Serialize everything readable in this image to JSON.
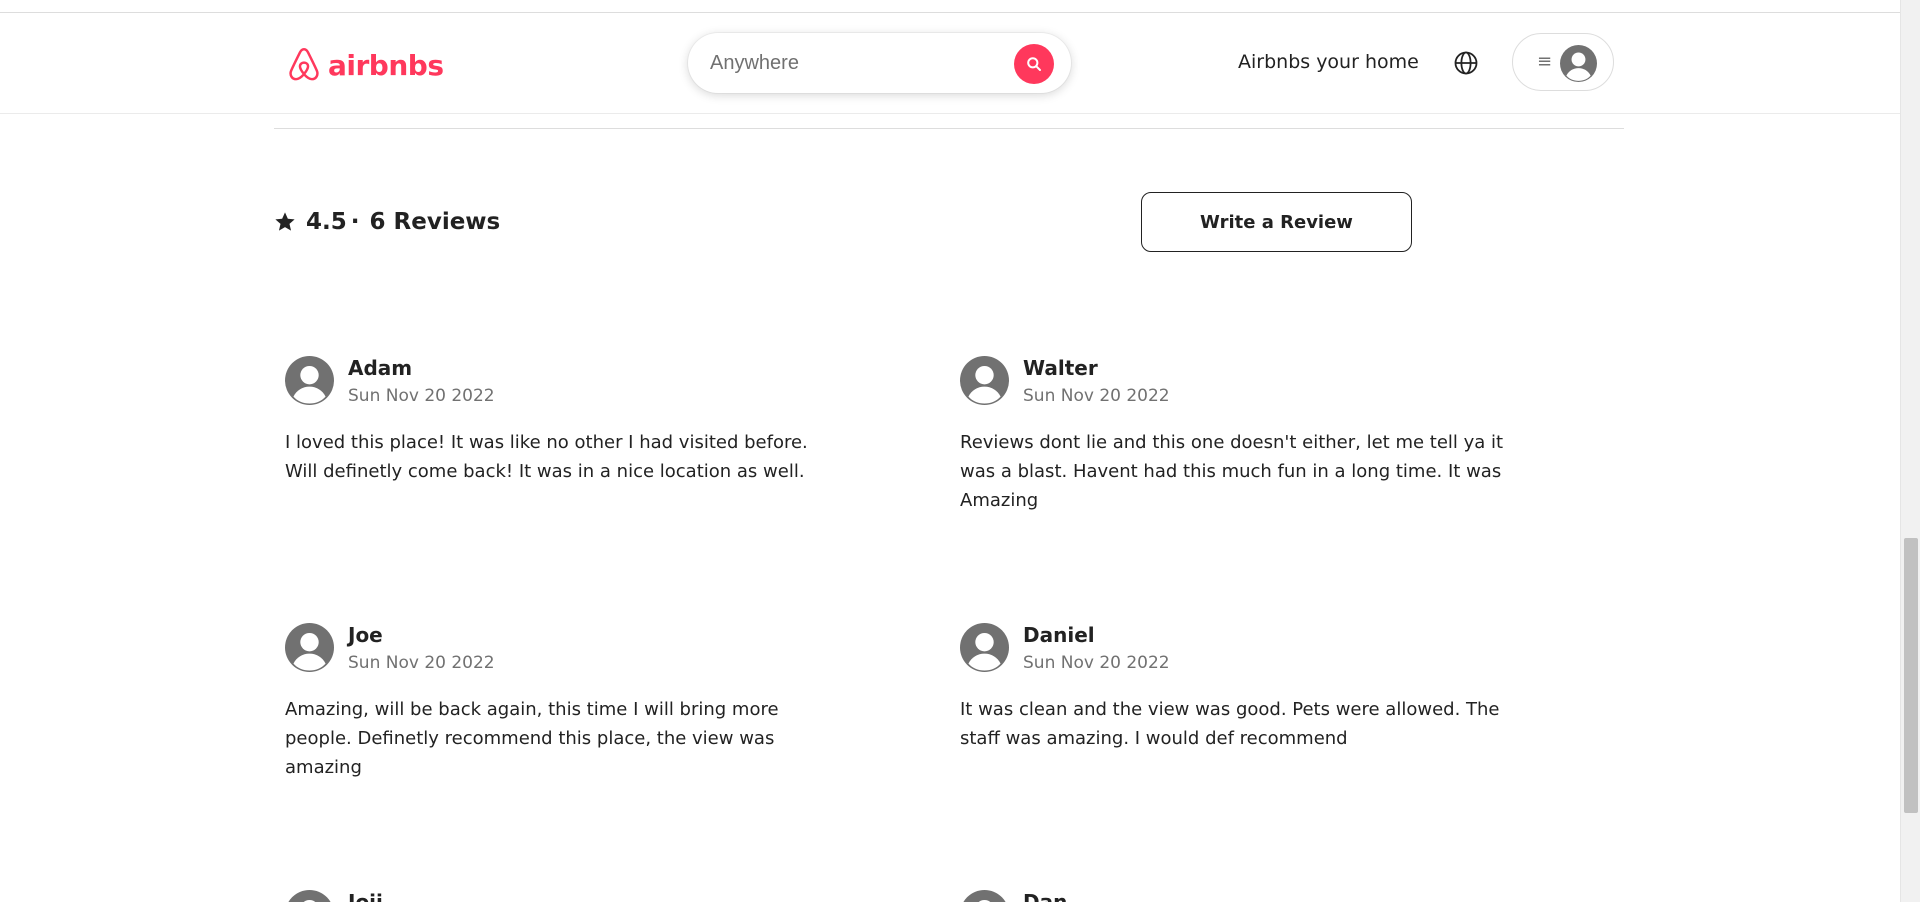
{
  "header": {
    "logo_text": "airbnbs",
    "search_placeholder": "Anywhere",
    "host_link": "Airbnbs your home",
    "menu_icon": "hamburger-icon",
    "brand_color": "#ff385c"
  },
  "rating_summary": {
    "rating": "4.5",
    "separator": "·",
    "reviews_label": "6 Reviews",
    "icon": "star-icon"
  },
  "write_review_button": "Write a Review",
  "reviews": [
    {
      "name": "Adam",
      "date": "Sun Nov 20 2022",
      "text": "I loved this place! It was like no other I had visited before. Will definetly come back! It was in a nice location as well."
    },
    {
      "name": "Walter",
      "date": "Sun Nov 20 2022",
      "text": "Reviews dont lie and this one doesn't either, let me tell ya it was a blast. Havent had this much fun in a long time. It was Amazing"
    },
    {
      "name": "Joe",
      "date": "Sun Nov 20 2022",
      "text": "Amazing, will be back again, this time I will bring more people. Definetly recommend this place, the view was amazing"
    },
    {
      "name": "Daniel",
      "date": "Sun Nov 20 2022",
      "text": "It was clean and the view was good. Pets were allowed. The staff was amazing. I would def recommend"
    },
    {
      "name": "Joji",
      "date": "",
      "text": ""
    },
    {
      "name": "Dan",
      "date": "",
      "text": ""
    }
  ]
}
